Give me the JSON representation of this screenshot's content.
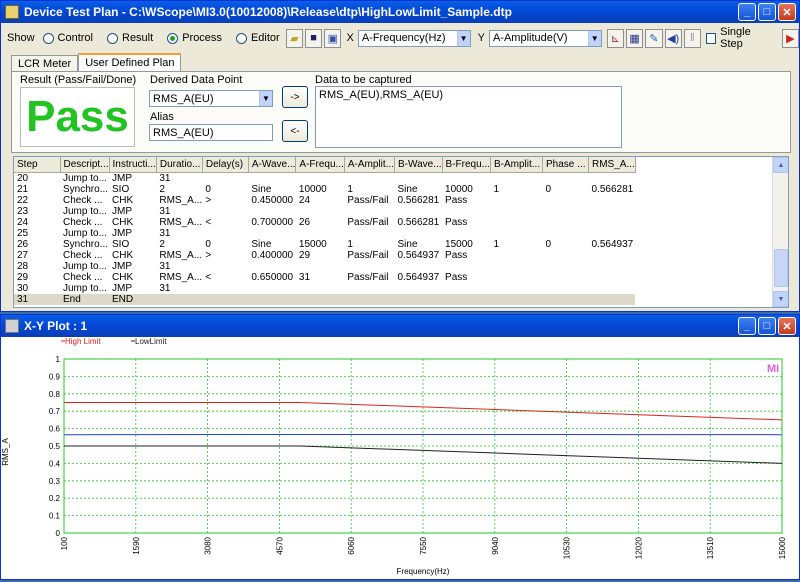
{
  "window": {
    "title": "Device Test Plan - C:\\WScope\\MI3.0(10012008)\\Release\\dtp\\HighLowLimit_Sample.dtp"
  },
  "toolbar": {
    "show_label": "Show",
    "modes": [
      {
        "label": "Control",
        "selected": false
      },
      {
        "label": "Result",
        "selected": false
      },
      {
        "label": "Process",
        "selected": true
      },
      {
        "label": "Editor",
        "selected": false
      }
    ],
    "x_label": "X",
    "x_value": "A-Frequency(Hz)",
    "y_label": "Y",
    "y_value": "A-Amplitude(V)",
    "single_step_label": "Single Step"
  },
  "tabs": [
    {
      "label": "LCR Meter",
      "active": false
    },
    {
      "label": "User Defined Plan",
      "active": true
    }
  ],
  "panel": {
    "result_label": "Result (Pass/Fail/Done)",
    "result_value": "Pass",
    "derived_label": "Derived Data Point",
    "derived_value": "RMS_A(EU)",
    "alias_label": "Alias",
    "alias_value": "RMS_A(EU)",
    "add_button": "->",
    "remove_button": "<-",
    "capture_label": "Data to be captured",
    "capture_value": "RMS_A(EU),RMS_A(EU)"
  },
  "grid": {
    "columns": [
      "Step",
      "Descript...",
      "Instructi...",
      "Duratio...",
      "Delay(s)",
      "A-Wave...",
      "A-Frequ...",
      "A-Amplit...",
      "B-Wave...",
      "B-Frequ...",
      "B-Amplit...",
      "Phase ...",
      "RMS_A..."
    ],
    "rows": [
      [
        "20",
        "Jump to...",
        "JMP",
        "31",
        "",
        "",
        "",
        "",
        "",
        "",
        "",
        "",
        ""
      ],
      [
        "21",
        "Synchro...",
        "SIO",
        "2",
        "0",
        "Sine",
        "10000",
        "1",
        "Sine",
        "10000",
        "1",
        "0",
        "0.566281"
      ],
      [
        "22",
        "Check ...",
        "CHK",
        "RMS_A...",
        ">",
        "0.450000",
        "24",
        "Pass/Fail",
        "0.566281",
        "Pass",
        "",
        "",
        ""
      ],
      [
        "23",
        "Jump to...",
        "JMP",
        "31",
        "",
        "",
        "",
        "",
        "",
        "",
        "",
        "",
        ""
      ],
      [
        "24",
        "Check ...",
        "CHK",
        "RMS_A...",
        "<",
        "0.700000",
        "26",
        "Pass/Fail",
        "0.566281",
        "Pass",
        "",
        "",
        ""
      ],
      [
        "25",
        "Jump to...",
        "JMP",
        "31",
        "",
        "",
        "",
        "",
        "",
        "",
        "",
        "",
        ""
      ],
      [
        "26",
        "Synchro...",
        "SIO",
        "2",
        "0",
        "Sine",
        "15000",
        "1",
        "Sine",
        "15000",
        "1",
        "0",
        "0.564937"
      ],
      [
        "27",
        "Check ...",
        "CHK",
        "RMS_A...",
        ">",
        "0.400000",
        "29",
        "Pass/Fail",
        "0.564937",
        "Pass",
        "",
        "",
        ""
      ],
      [
        "28",
        "Jump to...",
        "JMP",
        "31",
        "",
        "",
        "",
        "",
        "",
        "",
        "",
        "",
        ""
      ],
      [
        "29",
        "Check ...",
        "CHK",
        "RMS_A...",
        "<",
        "0.650000",
        "31",
        "Pass/Fail",
        "0.564937",
        "Pass",
        "",
        "",
        ""
      ],
      [
        "30",
        "Jump to...",
        "JMP",
        "31",
        "",
        "",
        "",
        "",
        "",
        "",
        "",
        "",
        ""
      ],
      [
        "31",
        "End",
        "END",
        "",
        "",
        "",
        "",
        "",
        "",
        "",
        "",
        "",
        ""
      ]
    ],
    "selected_row": 11
  },
  "plot_window": {
    "title": "X-Y Plot : 1"
  },
  "chart_data": {
    "type": "line",
    "title": "",
    "xlabel": "Frequency(Hz)",
    "ylabel": "RMS_A",
    "xlim": [
      100,
      15000
    ],
    "ylim": [
      0,
      1
    ],
    "x_ticks": [
      "100",
      "1590",
      "3080",
      "4570",
      "6060",
      "7550",
      "9040",
      "10530",
      "12020",
      "13510",
      "15000"
    ],
    "y_ticks": [
      "0",
      "0.1",
      "0.2",
      "0.3",
      "0.4",
      "0.5",
      "0.6",
      "0.7",
      "0.8",
      "0.9",
      "1"
    ],
    "grid": true,
    "legend": [
      "High Limit",
      "LowLimit"
    ],
    "badge": "MI",
    "colors": {
      "high": "#e02020",
      "low": "#202020",
      "data": "#2040e0",
      "grid": "#22cc22"
    },
    "series": [
      {
        "name": "High Limit",
        "x": [
          100,
          5000,
          10000,
          15000
        ],
        "y": [
          0.75,
          0.75,
          0.7,
          0.65
        ]
      },
      {
        "name": "LowLimit",
        "x": [
          100,
          5000,
          10000,
          15000
        ],
        "y": [
          0.5,
          0.5,
          0.45,
          0.4
        ]
      },
      {
        "x": [
          100,
          5000,
          10000,
          15000
        ],
        "y": [
          0.565,
          0.566,
          0.566,
          0.565
        ]
      }
    ]
  }
}
